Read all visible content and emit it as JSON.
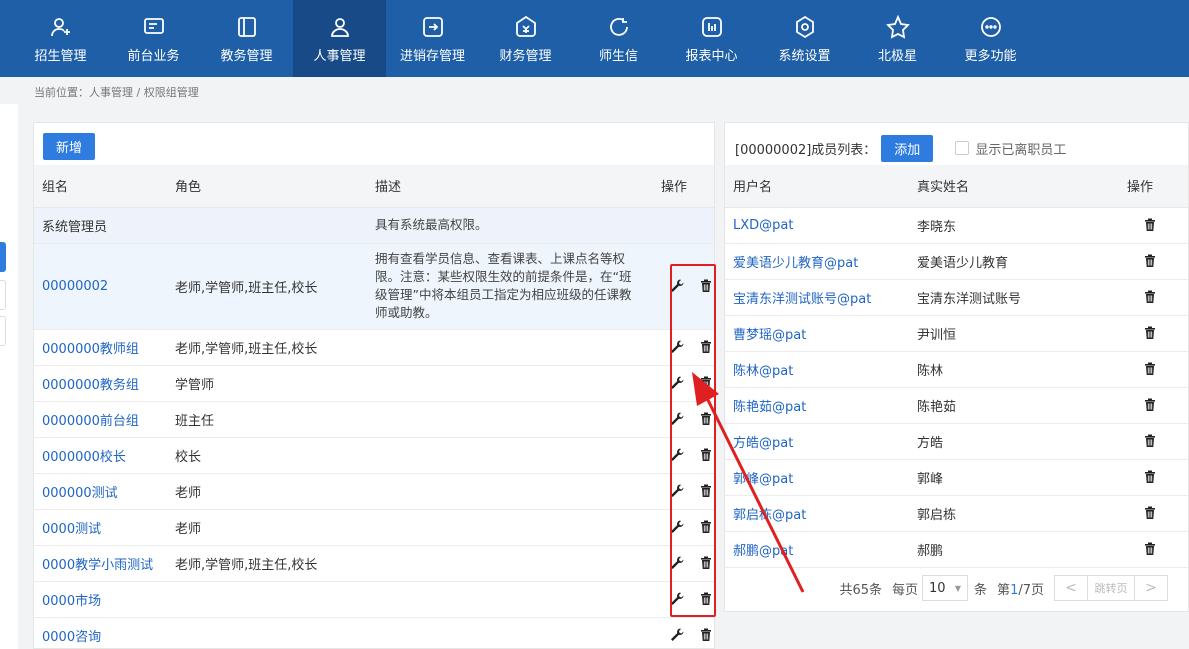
{
  "nav": [
    {
      "label": "招生管理",
      "icon": "person-add-icon"
    },
    {
      "label": "前台业务",
      "icon": "monitor-icon"
    },
    {
      "label": "教务管理",
      "icon": "book-icon"
    },
    {
      "label": "人事管理",
      "icon": "person-icon",
      "active": true
    },
    {
      "label": "进销存管理",
      "icon": "box-arrow-icon"
    },
    {
      "label": "财务管理",
      "icon": "wallet-icon"
    },
    {
      "label": "师生信",
      "icon": "chat-icon"
    },
    {
      "label": "报表中心",
      "icon": "chart-icon"
    },
    {
      "label": "系统设置",
      "icon": "gear-icon"
    },
    {
      "label": "北极星",
      "icon": "star-icon"
    },
    {
      "label": "更多功能",
      "icon": "more-icon"
    }
  ],
  "breadcrumb": "当前位置：人事管理 / 权限组管理",
  "left": {
    "add_label": "新增",
    "headers": {
      "name": "组名",
      "role": "角色",
      "desc": "描述",
      "ops": "操作"
    },
    "rows": [
      {
        "name": "系统管理员",
        "role": "",
        "desc": "具有系统最高权限。"
      },
      {
        "name": "00000002",
        "role": "老师,学管师,班主任,校长",
        "desc": "拥有查看学员信息、查看课表、上课点名等权限。注意：某些权限生效的前提条件是，在“班级管理”中将本组员工指定为相应班级的任课教师或助教。"
      },
      {
        "name": "0000000教师组",
        "role": "老师,学管师,班主任,校长",
        "desc": ""
      },
      {
        "name": "0000000教务组",
        "role": "学管师",
        "desc": ""
      },
      {
        "name": "0000000前台组",
        "role": "班主任",
        "desc": ""
      },
      {
        "name": "0000000校长",
        "role": "校长",
        "desc": ""
      },
      {
        "name": "000000测试",
        "role": "老师",
        "desc": ""
      },
      {
        "name": "0000测试",
        "role": "老师",
        "desc": ""
      },
      {
        "name": "0000教学小雨测试",
        "role": "老师,学管师,班主任,校长",
        "desc": ""
      },
      {
        "name": "0000市场",
        "role": "",
        "desc": ""
      },
      {
        "name": "0000咨询",
        "role": "",
        "desc": ""
      }
    ]
  },
  "right": {
    "title": "[00000002]成员列表：",
    "add_label": "添加",
    "checkbox_label": "显示已离职员工",
    "headers": {
      "user": "用户名",
      "real": "真实姓名",
      "ops": "操作"
    },
    "rows": [
      {
        "user": "LXD@pat",
        "real": "李晓东"
      },
      {
        "user": "爱美语少儿教育@pat",
        "real": "爱美语少儿教育"
      },
      {
        "user": "宝清东洋测试账号@pat",
        "real": "宝清东洋测试账号"
      },
      {
        "user": "曹梦瑶@pat",
        "real": "尹训恒"
      },
      {
        "user": "陈林@pat",
        "real": "陈林"
      },
      {
        "user": "陈艳茹@pat",
        "real": "陈艳茹"
      },
      {
        "user": "方皓@pat",
        "real": "方皓"
      },
      {
        "user": "郭峰@pat",
        "real": "郭峰"
      },
      {
        "user": "郭启栋@pat",
        "real": "郭启栋"
      },
      {
        "user": "郝鹏@pat",
        "real": "郝鹏"
      }
    ],
    "pager": {
      "total": "共65条",
      "per_page_label": "每页",
      "per_page": "10",
      "unit": "条",
      "page_prefix": "第",
      "page_current": "1",
      "page_suffix": "/7页",
      "jump": "跳转页",
      "prev": "<",
      "next": ">"
    }
  }
}
